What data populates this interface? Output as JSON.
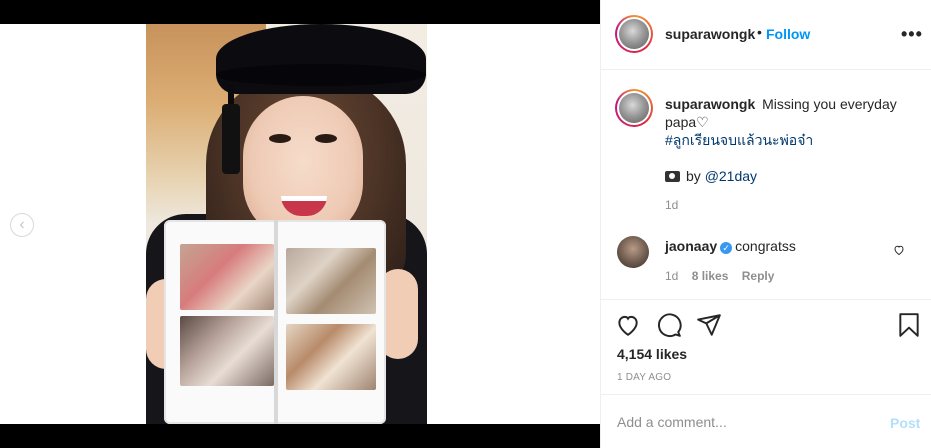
{
  "post": {
    "username": "suparawongk",
    "follow_label": "Follow",
    "dot": "•",
    "more_label": "•••"
  },
  "caption": {
    "username": "suparawongk",
    "text": "Missing you everyday papa♡",
    "hashtag": "#ลูกเรียนจบแล้วนะพ่อจ๋า",
    "credit_prefix": "by",
    "credit_mention": "@21day",
    "time": "1d"
  },
  "comment": {
    "username": "jaonaay",
    "text": "congratss",
    "time": "1d",
    "likes": "8 likes",
    "reply": "Reply"
  },
  "actions": {
    "likes": "4,154 likes",
    "time": "1 DAY AGO"
  },
  "add_comment": {
    "placeholder": "Add a comment...",
    "post_label": "Post"
  },
  "nav": {
    "prev": "‹"
  }
}
